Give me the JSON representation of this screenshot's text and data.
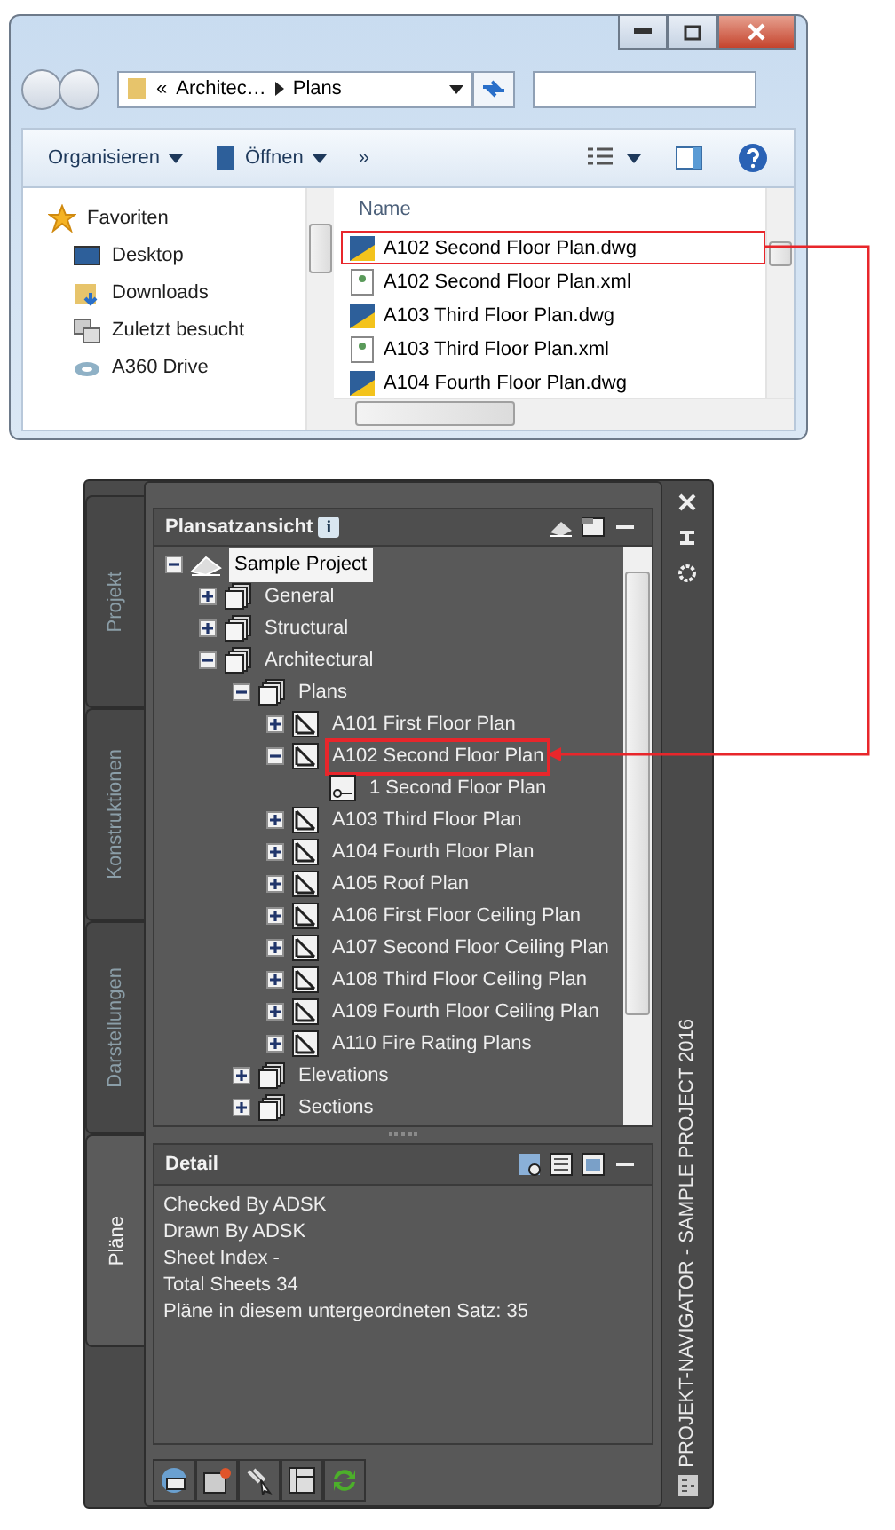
{
  "explorer": {
    "address": {
      "chevron": "«",
      "parts": [
        "Architec…",
        "Plans"
      ]
    },
    "toolbar": [
      {
        "label": "Organisieren",
        "kind": "menu"
      },
      {
        "label": "Öffnen",
        "kind": "open"
      },
      {
        "label": "»",
        "kind": "more"
      }
    ],
    "sidebar": [
      {
        "label": "Favoriten",
        "kind": "star"
      },
      {
        "label": "Desktop",
        "kind": "desktop"
      },
      {
        "label": "Downloads",
        "kind": "downloads"
      },
      {
        "label": "Zuletzt besucht",
        "kind": "recent"
      },
      {
        "label": "A360 Drive",
        "kind": "cloud"
      }
    ],
    "column": "Name",
    "files": [
      {
        "name": "A102 Second Floor Plan.dwg",
        "kind": "dwg",
        "marked": true
      },
      {
        "name": "A102 Second Floor Plan.xml",
        "kind": "xml",
        "marked": false
      },
      {
        "name": "A103 Third Floor Plan.dwg",
        "kind": "dwg",
        "marked": false
      },
      {
        "name": "A103 Third Floor Plan.xml",
        "kind": "xml",
        "marked": false
      },
      {
        "name": "A104 Fourth Floor Plan.dwg",
        "kind": "dwg",
        "marked": false
      }
    ]
  },
  "palette": {
    "title": "PROJEKT-NAVIGATOR - SAMPLE PROJECT 2016",
    "tabs": [
      {
        "label": "Projekt",
        "selected": false
      },
      {
        "label": "Konstruktionen",
        "selected": false
      },
      {
        "label": "Darstellungen",
        "selected": false
      },
      {
        "label": "Pläne",
        "selected": true
      }
    ],
    "tree_title": "Plansatzansicht",
    "info": "i",
    "tree": [
      {
        "label": "Sample Project",
        "kind": "project",
        "expanded": true,
        "selected": true,
        "marked": false,
        "children": [
          {
            "label": "General",
            "kind": "subset",
            "expanded": false,
            "selected": false,
            "marked": false
          },
          {
            "label": "Structural",
            "kind": "subset",
            "expanded": false,
            "selected": false,
            "marked": false
          },
          {
            "label": "Architectural",
            "kind": "subset",
            "expanded": true,
            "selected": false,
            "marked": false,
            "children": [
              {
                "label": "Plans",
                "kind": "subset",
                "expanded": true,
                "selected": false,
                "marked": false,
                "children": [
                  {
                    "label": "A101 First Floor Plan",
                    "kind": "sheet",
                    "expanded": false,
                    "selected": false,
                    "marked": false
                  },
                  {
                    "label": "A102 Second Floor Plan",
                    "kind": "sheet",
                    "expanded": true,
                    "selected": false,
                    "marked": true,
                    "children": [
                      {
                        "label": "1 Second Floor Plan",
                        "kind": "view",
                        "selected": false,
                        "marked": false
                      }
                    ]
                  },
                  {
                    "label": "A103 Third Floor Plan",
                    "kind": "sheet",
                    "expanded": false,
                    "selected": false,
                    "marked": false
                  },
                  {
                    "label": "A104 Fourth Floor Plan",
                    "kind": "sheet",
                    "expanded": false,
                    "selected": false,
                    "marked": false
                  },
                  {
                    "label": "A105 Roof Plan",
                    "kind": "sheet",
                    "expanded": false,
                    "selected": false,
                    "marked": false
                  },
                  {
                    "label": "A106 First Floor Ceiling Plan",
                    "kind": "sheet",
                    "expanded": false,
                    "selected": false,
                    "marked": false
                  },
                  {
                    "label": "A107 Second Floor Ceiling Plan",
                    "kind": "sheet",
                    "expanded": false,
                    "selected": false,
                    "marked": false
                  },
                  {
                    "label": "A108 Third Floor Ceiling Plan",
                    "kind": "sheet",
                    "expanded": false,
                    "selected": false,
                    "marked": false
                  },
                  {
                    "label": "A109 Fourth Floor Ceiling Plan",
                    "kind": "sheet",
                    "expanded": false,
                    "selected": false,
                    "marked": false
                  },
                  {
                    "label": "A110 Fire Rating Plans",
                    "kind": "sheet",
                    "expanded": false,
                    "selected": false,
                    "marked": false
                  }
                ]
              },
              {
                "label": "Elevations",
                "kind": "subset",
                "expanded": false,
                "selected": false,
                "marked": false
              },
              {
                "label": "Sections",
                "kind": "subset",
                "expanded": false,
                "selected": false,
                "marked": false
              }
            ]
          }
        ]
      }
    ],
    "detail_title": "Detail",
    "detail": [
      "Checked By ADSK",
      "Drawn By ADSK",
      "Sheet Index -",
      "Total Sheets 34",
      "Pläne in diesem untergeordneten Satz: 35"
    ]
  }
}
